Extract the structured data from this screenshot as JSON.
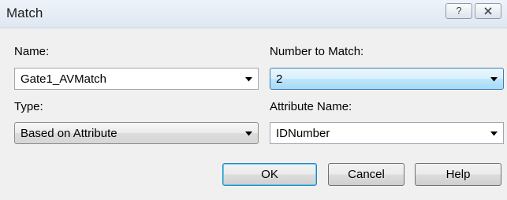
{
  "window": {
    "title": "Match",
    "help_glyph": "?",
    "close_icon": "close-icon"
  },
  "fields": {
    "name": {
      "label": "Name:",
      "value": "Gate1_AVMatch"
    },
    "number_to_match": {
      "label": "Number to Match:",
      "value": "2"
    },
    "type": {
      "label": "Type:",
      "value": "Based on Attribute"
    },
    "attribute_name": {
      "label": "Attribute Name:",
      "value": "IDNumber"
    }
  },
  "buttons": {
    "ok": "OK",
    "cancel": "Cancel",
    "help": "Help"
  },
  "colors": {
    "dialog_bg": "#f0f0f0",
    "focus_border": "#3c7fb1"
  }
}
